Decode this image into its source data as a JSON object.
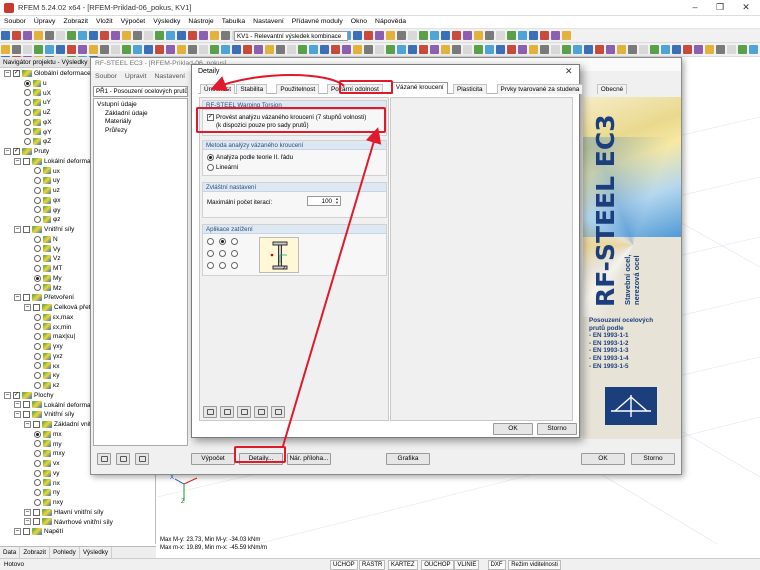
{
  "app": {
    "title": "RFEM 5.24.02 x64 - [RFEM-Priklad-06_pokus, KV1]"
  },
  "menu": [
    "Soubor",
    "Úpravy",
    "Zobrazit",
    "Vložit",
    "Výpočet",
    "Výsledky",
    "Nástroje",
    "Tabulka",
    "Nastavení",
    "Přídavné moduly",
    "Okno",
    "Nápověda"
  ],
  "toolbar": {
    "combo_value": "KV1 - Relevantní výsledek kombinace"
  },
  "navigator": {
    "title": "Navigátor projektu - Výsledky",
    "items": [
      {
        "label": "Globální deformace",
        "t": "cbx",
        "lvl": 0
      },
      {
        "label": "u",
        "t": "rd",
        "on": true,
        "lvl": 2
      },
      {
        "label": "uX",
        "t": "rd",
        "lvl": 2
      },
      {
        "label": "uY",
        "t": "rd",
        "lvl": 2
      },
      {
        "label": "uZ",
        "t": "rd",
        "lvl": 2
      },
      {
        "label": "φX",
        "t": "rd",
        "lvl": 2
      },
      {
        "label": "φY",
        "t": "rd",
        "lvl": 2
      },
      {
        "label": "φZ",
        "t": "rd",
        "lvl": 2
      },
      {
        "label": "Pruty",
        "t": "cbx",
        "lvl": 0
      },
      {
        "label": "Lokální deformace",
        "t": "exp",
        "lvl": 1
      },
      {
        "label": "ux",
        "t": "rd",
        "lvl": 3
      },
      {
        "label": "uy",
        "t": "rd",
        "lvl": 3
      },
      {
        "label": "uz",
        "t": "rd",
        "lvl": 3
      },
      {
        "label": "φx",
        "t": "rd",
        "lvl": 3
      },
      {
        "label": "φy",
        "t": "rd",
        "lvl": 3
      },
      {
        "label": "φz",
        "t": "rd",
        "lvl": 3
      },
      {
        "label": "Vnitřní síly",
        "t": "exp",
        "lvl": 1
      },
      {
        "label": "N",
        "t": "rd",
        "lvl": 3
      },
      {
        "label": "Vy",
        "t": "rd",
        "lvl": 3
      },
      {
        "label": "Vz",
        "t": "rd",
        "lvl": 3
      },
      {
        "label": "MT",
        "t": "rd",
        "lvl": 3
      },
      {
        "label": "My",
        "t": "rd",
        "on": true,
        "lvl": 3
      },
      {
        "label": "Mz",
        "t": "rd",
        "lvl": 3
      },
      {
        "label": "Přetvoření",
        "t": "exp",
        "lvl": 1
      },
      {
        "label": "Celková přetvoření",
        "t": "exp",
        "lvl": 2
      },
      {
        "label": "εx,max",
        "t": "rd",
        "lvl": 3
      },
      {
        "label": "εx,min",
        "t": "rd",
        "lvl": 3
      },
      {
        "label": "max|εu|",
        "t": "rd",
        "lvl": 3
      },
      {
        "label": "γxy",
        "t": "rd",
        "lvl": 3
      },
      {
        "label": "γxz",
        "t": "rd",
        "lvl": 3
      },
      {
        "label": "κx",
        "t": "rd",
        "lvl": 3
      },
      {
        "label": "κy",
        "t": "rd",
        "lvl": 3
      },
      {
        "label": "κz",
        "t": "rd",
        "lvl": 3
      },
      {
        "label": "Plochy",
        "t": "cbx",
        "lvl": 0
      },
      {
        "label": "Lokální deformace",
        "t": "exp",
        "lvl": 1
      },
      {
        "label": "Vnitřní síly",
        "t": "exp",
        "lvl": 1
      },
      {
        "label": "Základní vnitřní síly",
        "t": "exp",
        "lvl": 2
      },
      {
        "label": "mx",
        "t": "rd",
        "on": true,
        "lvl": 3
      },
      {
        "label": "my",
        "t": "rd",
        "lvl": 3
      },
      {
        "label": "mxy",
        "t": "rd",
        "lvl": 3
      },
      {
        "label": "vx",
        "t": "rd",
        "lvl": 3
      },
      {
        "label": "vy",
        "t": "rd",
        "lvl": 3
      },
      {
        "label": "nx",
        "t": "rd",
        "lvl": 3
      },
      {
        "label": "ny",
        "t": "rd",
        "lvl": 3
      },
      {
        "label": "nxy",
        "t": "rd",
        "lvl": 3
      },
      {
        "label": "Hlavní vnitřní síly",
        "t": "exp",
        "lvl": 2
      },
      {
        "label": "Návrhové vnitřní síly",
        "t": "exp",
        "lvl": 2
      },
      {
        "label": "Napětí",
        "t": "exp",
        "lvl": 1
      }
    ],
    "tabs": [
      "Data",
      "Zobrazit",
      "Pohledy",
      "Výsledky"
    ]
  },
  "coords": [
    "Max M-y: 23.73, Min M-y: -34.03 kNm",
    "Max m-x: 19.89, Min m-x: -45.59 kNm/m"
  ],
  "statusbar": {
    "left": "Hotovo",
    "items": [
      "UCHOP",
      "RASTR",
      "KARTEZ",
      "OUCHOP",
      "VLINIE",
      "DXF",
      "Režim viditelnosti"
    ]
  },
  "rfsteel": {
    "title": "RF-STEEL EC3 - [RFEM-Priklad-06_pokus]",
    "menu": [
      "Soubor",
      "Upravit",
      "Nastavení",
      "N"
    ],
    "case": "PŘ1 - Posouzení ocelových prutů",
    "tree": [
      "Vstupní údaje",
      "Základní údaje",
      "Materiály",
      "Průřezy"
    ],
    "buttons": {
      "vypocet": "Výpočet",
      "detaily": "Detaily...",
      "priloha": "Nár. příloha...",
      "grafika": "Grafika",
      "ok": "OK",
      "storno": "Storno"
    },
    "brand": {
      "name": "RF-STEEL EC3",
      "sub1": "Stavební ocel,",
      "sub2": "nerezová ocel",
      "desc": [
        "Posouzení ocelových",
        "prutů podle",
        "- EN 1993-1-1",
        "- EN 1993-1-2",
        "- EN 1993-1-3",
        "- EN 1993-1-4",
        "- EN 1993-1-5"
      ]
    }
  },
  "dialog": {
    "title": "Detaily",
    "tabs": [
      "Únosnost",
      "Stabilita",
      "Použitelnost",
      "Požární odolnost",
      "Vázané kroucení",
      "Plasticita",
      "Prvky tvarované za studena",
      "Obecné"
    ],
    "active_tab": "Vázané kroucení",
    "g1": {
      "head": "RF-STEEL Warping Torsion",
      "check": "Provést analýzu vázaného kroucení (7 stupňů volnosti)",
      "note": "(k dispozici pouze pro sady prutů)",
      "checked": true
    },
    "g2": {
      "head": "Metoda analýzy vázaného kroucení",
      "opt1": "Analýza podle teorie II. řádu",
      "opt2": "Lineární",
      "selected": "Analýza podle teorie II. řádu"
    },
    "g3": {
      "head": "Zvláštní nastavení",
      "label": "Maximální počet iterací:",
      "value": "100"
    },
    "g4": {
      "head": "Aplikace zatížení",
      "selected_position": "top-center"
    },
    "buttons": {
      "ok": "OK",
      "storno": "Storno"
    }
  }
}
